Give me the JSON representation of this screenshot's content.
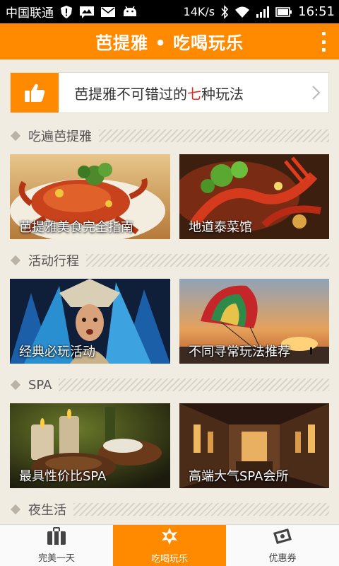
{
  "status_bar": {
    "carrier": "中国联通",
    "net_speed": "14K/s",
    "time": "16:51",
    "icons": [
      "shield-alert-icon",
      "image-message-icon",
      "mail-icon",
      "android-icon",
      "bluetooth-icon",
      "wifi-icon",
      "signal-icon",
      "battery-icon"
    ]
  },
  "header": {
    "title": "芭提雅 • 吃喝玩乐",
    "menu_icon": "more-vertical-icon",
    "color": "#ff8a00"
  },
  "banner": {
    "icon": "thumbs-up-icon",
    "text_before": "芭提雅不可错过的",
    "text_highlight": "七",
    "text_after": "种玩法",
    "highlight_color": "#e8281e"
  },
  "sections": [
    {
      "title": "吃遍芭提雅",
      "tiles": [
        {
          "label": "芭提雅美食完全指南"
        },
        {
          "label": "地道泰菜馆"
        }
      ]
    },
    {
      "title": "活动行程",
      "tiles": [
        {
          "label": "经典必玩活动"
        },
        {
          "label": "不同寻常玩法推荐"
        }
      ]
    },
    {
      "title": "SPA",
      "tiles": [
        {
          "label": "最具性价比SPA"
        },
        {
          "label": "高端大气SPA会所"
        }
      ]
    },
    {
      "title": "夜生活",
      "tiles": []
    }
  ],
  "tabbar": {
    "tabs": [
      {
        "label": "完美一天",
        "icon": "luggage-icon",
        "active": false
      },
      {
        "label": "吃喝玩乐",
        "icon": "party-icon",
        "active": true
      },
      {
        "label": "优惠券",
        "icon": "coupon-icon",
        "active": false
      }
    ]
  }
}
